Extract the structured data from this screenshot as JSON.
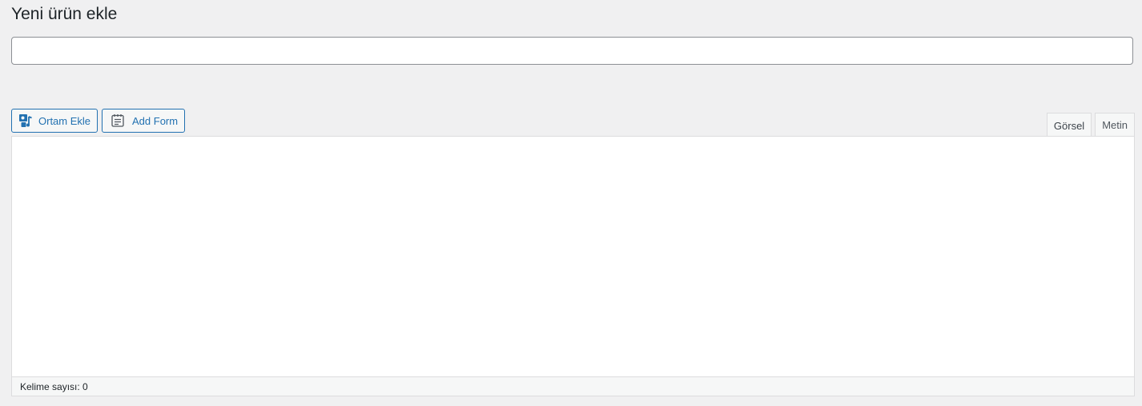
{
  "page": {
    "title": "Yeni ürün ekle"
  },
  "title_input": {
    "value": "",
    "placeholder": ""
  },
  "toolbar": {
    "add_media_label": "Ortam Ekle",
    "add_media_icon": "media-icon",
    "add_form_label": "Add Form",
    "add_form_icon": "form-icon"
  },
  "editor": {
    "tabs": [
      {
        "label": "Görsel",
        "active": true
      },
      {
        "label": "Metin",
        "active": false
      }
    ],
    "content": ""
  },
  "status_bar": {
    "word_count": "Kelime sayısı: 0"
  },
  "colors": {
    "accent": "#2271b1",
    "background": "#f0f0f1",
    "border": "#dcdcde"
  }
}
